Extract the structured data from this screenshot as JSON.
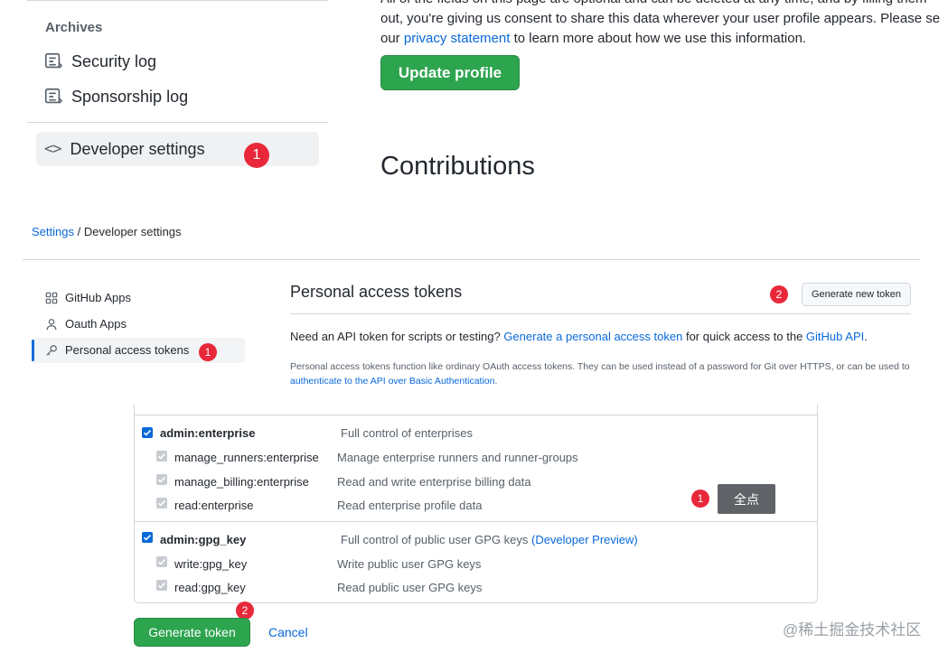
{
  "top": {
    "archives_heading": "Archives",
    "security_log": "Security log",
    "sponsorship_log": "Sponsorship log",
    "developer_settings": "Developer settings",
    "intro_line1": "All of the fields on this page are optional and can be deleted at any time, and by filling them",
    "intro_line2": "out, you're giving us consent to share this data wherever your user profile appears. Please se",
    "intro_line3_link": "privacy statement",
    "intro_line3_pre": "our",
    "intro_line3_post": "to learn more about how we use this information.",
    "update_profile": "Update profile",
    "contributions": "Contributions",
    "badge_1": "1"
  },
  "middle": {
    "breadcrumb_settings": "Settings",
    "breadcrumb_sep": "/",
    "breadcrumb_current": "Developer settings",
    "nav": {
      "github_apps": "GitHub Apps",
      "oauth_apps": "Oauth Apps",
      "personal_access_tokens": "Personal access tokens"
    },
    "pat_title": "Personal access tokens",
    "generate_new_token": "Generate new token",
    "need_api_pre": "Need an API token for scripts or testing?",
    "need_api_link1": "Generate a personal access token",
    "need_api_mid": "for quick access to the",
    "need_api_link2": "GitHub API",
    "need_api_post": ".",
    "desc_text": "Personal access tokens function like ordinary OAuth access tokens. They can be used instead of a password for Git over HTTPS, or can be used to",
    "desc_link": "authenticate to the API over Basic Authentication",
    "desc_post": ".",
    "badge_1": "1",
    "badge_2": "2"
  },
  "bottom": {
    "scopes": [
      {
        "name": "admin:enterprise",
        "desc": "Full control of enterprises"
      },
      {
        "name": "manage_runners:enterprise",
        "desc": "Manage enterprise runners and runner-groups"
      },
      {
        "name": "manage_billing:enterprise",
        "desc": "Read and write enterprise billing data"
      },
      {
        "name": "read:enterprise",
        "desc": "Read enterprise profile data"
      },
      {
        "name": "admin:gpg_key",
        "desc": "Full control of public user GPG keys",
        "desc_link": "(Developer Preview)"
      },
      {
        "name": "write:gpg_key",
        "desc": "Write public user GPG keys"
      },
      {
        "name": "read:gpg_key",
        "desc": "Read public user GPG keys"
      }
    ],
    "tooltip": "全点",
    "badge_1": "1",
    "badge_2": "2",
    "generate_token": "Generate token",
    "cancel": "Cancel"
  },
  "watermark": "@稀土掘金技术社区",
  "colors": {
    "accent": "#0969da",
    "primary_button": "#2da44e",
    "badge": "#e8283a"
  }
}
